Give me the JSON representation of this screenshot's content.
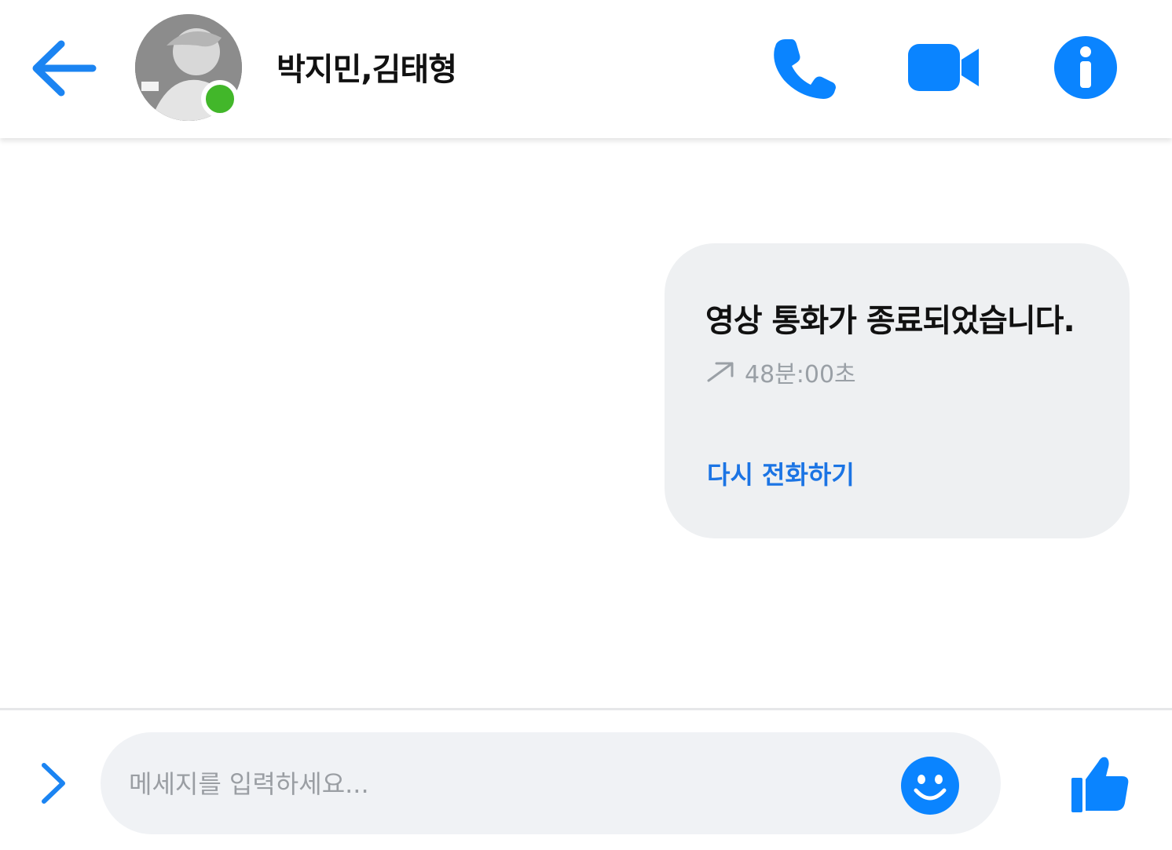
{
  "header": {
    "title": "박지민,김태형",
    "back_icon": "arrow-left-icon",
    "phone_icon": "phone-icon",
    "video_icon": "video-camera-icon",
    "info_icon": "info-icon",
    "online": true
  },
  "message": {
    "title": "영상 통화가 종료되었습니다.",
    "duration": "48분:00초",
    "duration_icon": "outgoing-arrow-icon",
    "action_label": "다시 전화하기"
  },
  "composer": {
    "placeholder": "메세지를 입력하세요...",
    "expand_icon": "chevron-right-icon",
    "emoji_icon": "smiley-icon",
    "like_icon": "thumbs-up-icon"
  },
  "colors": {
    "accent": "#1b74e4",
    "icon_blue": "#0a84ff",
    "online_green": "#42b72a",
    "bubble_bg": "#eef0f2",
    "input_bg": "#f0f2f5"
  }
}
